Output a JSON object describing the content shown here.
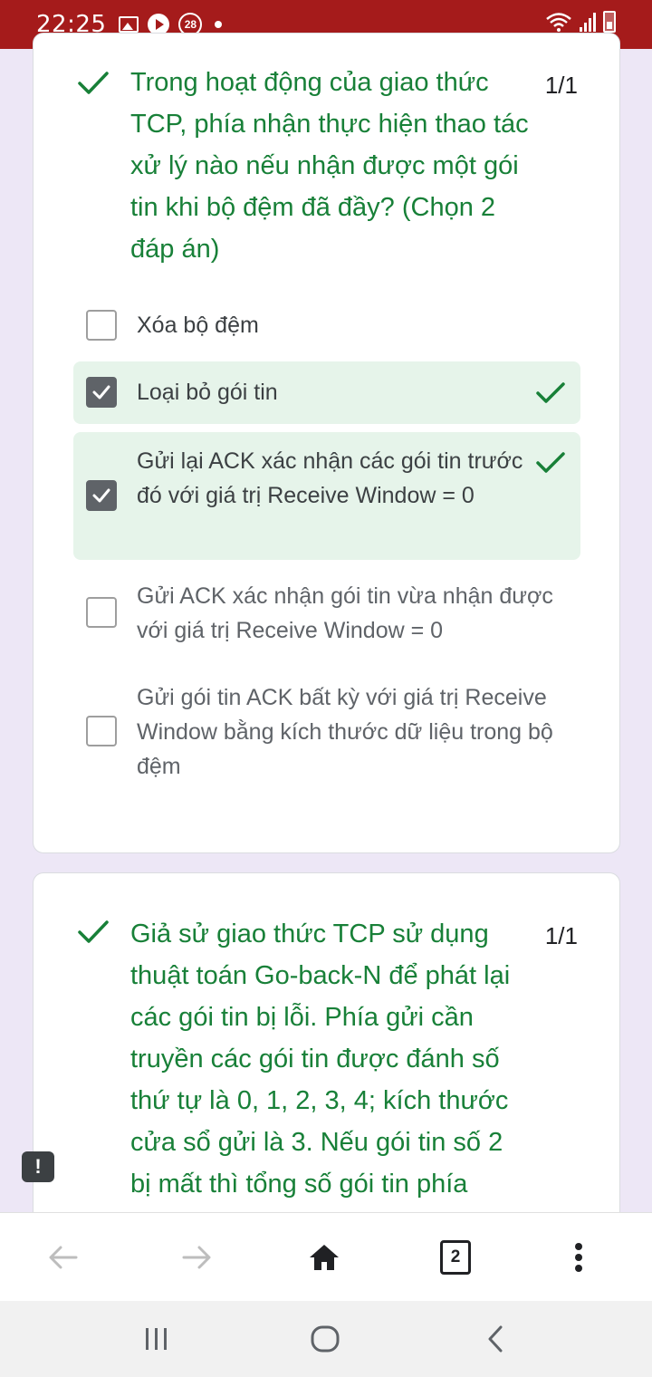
{
  "status_bar": {
    "time": "22:25",
    "notification_badge": "28",
    "icons": [
      "gallery-icon",
      "play-icon",
      "badge-icon",
      "dot-icon",
      "wifi-icon",
      "signal-icon",
      "battery-icon"
    ]
  },
  "question1": {
    "title": "Trong hoạt động của giao thức TCP, phía nhận thực hiện thao tác xử lý nào nếu nhận được một gói tin khi bộ đệm đã đầy? (Chọn 2 đáp án)",
    "score": "1/1",
    "options": [
      {
        "label": "Xóa bộ đệm",
        "checked": false,
        "correct": false
      },
      {
        "label": "Loại bỏ gói tin",
        "checked": true,
        "correct": true
      },
      {
        "label": "Gửi lại ACK xác nhận các gói tin trước đó với giá trị Receive Window = 0",
        "checked": true,
        "correct": true
      },
      {
        "label": "Gửi ACK xác nhận gói tin vừa nhận được với giá trị Receive Window = 0",
        "checked": false,
        "correct": false
      },
      {
        "label": "Gửi gói tin ACK bất kỳ với giá trị Receive Window bằng kích thước dữ liệu trong bộ đệm",
        "checked": false,
        "correct": false
      }
    ]
  },
  "question2": {
    "title": "Giả sử giao thức TCP sử dụng thuật toán Go-back-N để phát lại các gói tin bị lỗi. Phía gửi cần truyền các gói tin được đánh số thứ tự là 0, 1, 2, 3, 4; kích thước cửa sổ gửi là 3. Nếu gói tin số 2 bị mất thì tổng số gói tin phía",
    "score": "1/1"
  },
  "feedback_button": {
    "label": "!"
  },
  "browser_toolbar": {
    "tab_count": "2",
    "icons": [
      "back-arrow-icon",
      "forward-arrow-icon",
      "home-icon",
      "tab-switcher-icon",
      "more-vert-icon"
    ]
  },
  "system_nav": {
    "icons": [
      "recent-apps-icon",
      "home-circle-icon",
      "back-chevron-icon"
    ]
  },
  "colors": {
    "status_bar": "#a51b1b",
    "correct_green": "#188038",
    "correct_bg": "#e6f4ea",
    "page_bg": "#ede7f6"
  }
}
